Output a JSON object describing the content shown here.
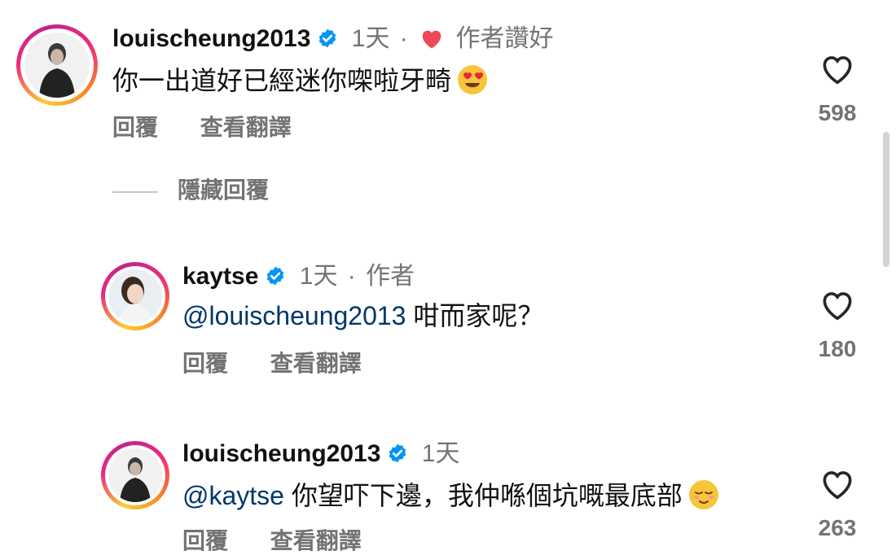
{
  "comments": [
    {
      "username": "louischeung2013",
      "time": "1天",
      "separator": "·",
      "author_liked": "作者讚好",
      "text": "你一出道好已經迷你㗎啦牙畸",
      "emoji": "heart-eyes-emoji",
      "reply_label": "回覆",
      "translate_label": "查看翻譯",
      "likes": "598"
    },
    {
      "username": "kaytse",
      "time": "1天",
      "separator": "·",
      "author_tag": "作者",
      "mention": "@louischeung2013",
      "text": " 咁而家呢？",
      "reply_label": "回覆",
      "translate_label": "查看翻譯",
      "likes": "180"
    },
    {
      "username": "louischeung2013",
      "time": "1天",
      "mention": "@kaytse",
      "text": " 你望吓下邊，我仲喺個坑嘅最底部",
      "emoji": "relieved-face-emoji",
      "reply_label": "回覆",
      "translate_label": "查看翻譯",
      "likes": "263"
    }
  ],
  "hide_replies_label": "隱藏回覆",
  "colors": {
    "like_heart": "#ed4956",
    "verified": "#0095f6",
    "mention": "#00376b",
    "muted": "#737373"
  }
}
